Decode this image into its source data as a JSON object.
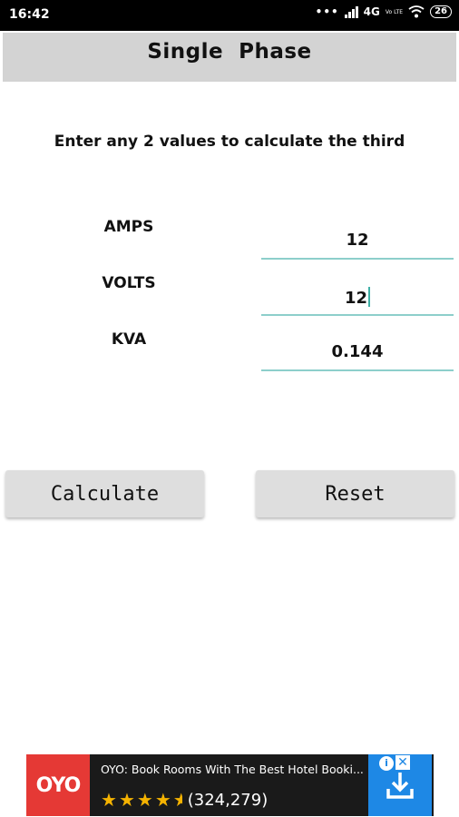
{
  "status_bar": {
    "time": "16:42",
    "network": "4G",
    "volte": "Vo LTE",
    "battery": "26"
  },
  "header": {
    "title": "Single  Phase"
  },
  "instruction": "Enter any 2 values to calculate the third",
  "fields": [
    {
      "label": "AMPS",
      "value": "12"
    },
    {
      "label": "VOLTS",
      "value": "12"
    },
    {
      "label": "KVA",
      "value": "0.144"
    }
  ],
  "buttons": {
    "calculate": "Calculate",
    "reset": "Reset"
  },
  "ad": {
    "brand": "OYO",
    "headline": "OYO: Book Rooms With The Best Hotel Booki...",
    "rating": 4.5,
    "review_count": "(324,279)",
    "colors": {
      "brand_red": "#e53935",
      "download_blue": "#1e88e5",
      "star": "#f5b301"
    }
  },
  "colors": {
    "field_underline": "#8dcfcb",
    "caret": "#3fb0a6",
    "titlebar": "#d3d3d3"
  }
}
